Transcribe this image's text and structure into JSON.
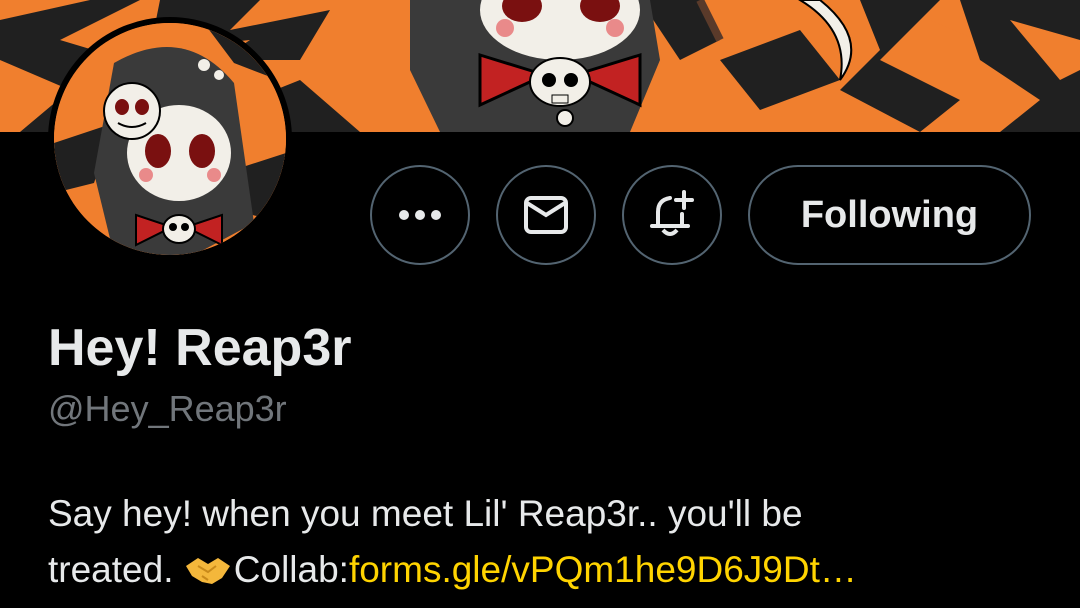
{
  "profile": {
    "display_name": "Hey! Reap3r",
    "handle": "@Hey_Reap3r",
    "bio_line1": "Say hey! when you meet Lil' Reap3r.. you'll be",
    "bio_line2_prefix": "treated.",
    "bio_collab_label": "Collab:",
    "bio_link": "forms.gle/vPQm1he9D6J9Dt…"
  },
  "actions": {
    "more_icon": "more-icon",
    "message_icon": "mail-icon",
    "notify_icon": "bell-plus-icon",
    "follow_label": "Following"
  },
  "colors": {
    "background": "#000000",
    "banner_orange": "#f07f2e",
    "link": "#ffd400",
    "border": "#536471"
  }
}
